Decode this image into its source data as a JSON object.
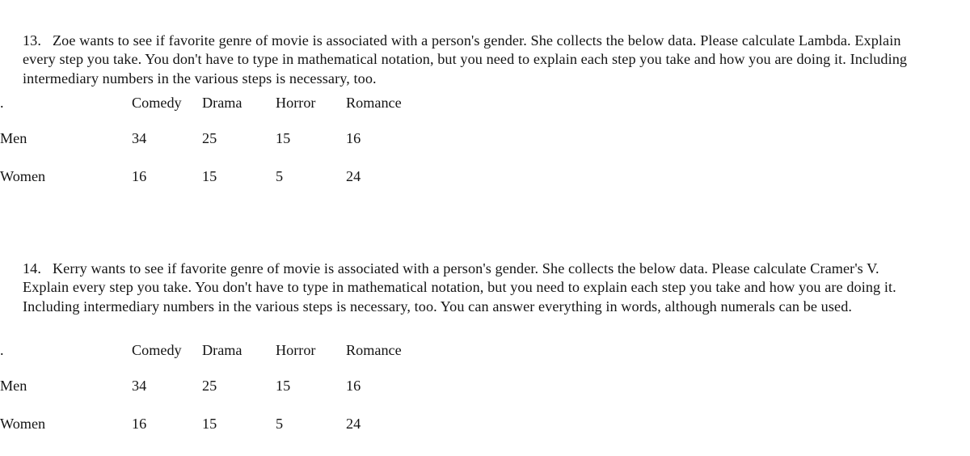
{
  "document": {
    "title": "Statistics homework questions 13 and 14",
    "background_color": "#ffffff",
    "text_color": "#141414"
  },
  "questions": [
    {
      "number": "13.",
      "body": "Zoe wants to see if favorite genre of movie is associated with a person's gender.  She collects the below data.  Please calculate Lambda.  Explain every step you take.  You don't have to type in mathematical notation, but you need to explain each step you take and how you are doing it.  Including intermediary numbers in the various steps is necessary, too."
    },
    {
      "number": "14.",
      "body": "Kerry wants to see if favorite genre of movie is associated with a person's gender.  She collects the below data.  Please calculate Cramer's V.  Explain every step you take.  You don't have to type in mathematical notation, but you need to explain each step you take and how you are doing it.  Including intermediary numbers in the various steps is necessary, too.  You can answer everything in words, although numerals can be used."
    }
  ],
  "tables": [
    {
      "corner_label": ".",
      "columns": [
        "Comedy",
        "Drama",
        "Horror",
        "Romance"
      ],
      "rows": [
        {
          "label": "Men",
          "values": [
            "34",
            "25",
            "15",
            "16"
          ]
        },
        {
          "label": "Women",
          "values": [
            "16",
            "15",
            "5",
            "24"
          ]
        }
      ]
    },
    {
      "corner_label": ".",
      "columns": [
        "Comedy",
        "Drama",
        "Horror",
        "Romance"
      ],
      "rows": [
        {
          "label": "Men",
          "values": [
            "34",
            "25",
            "15",
            "16"
          ]
        },
        {
          "label": "Women",
          "values": [
            "16",
            "15",
            "5",
            "24"
          ]
        }
      ]
    }
  ]
}
